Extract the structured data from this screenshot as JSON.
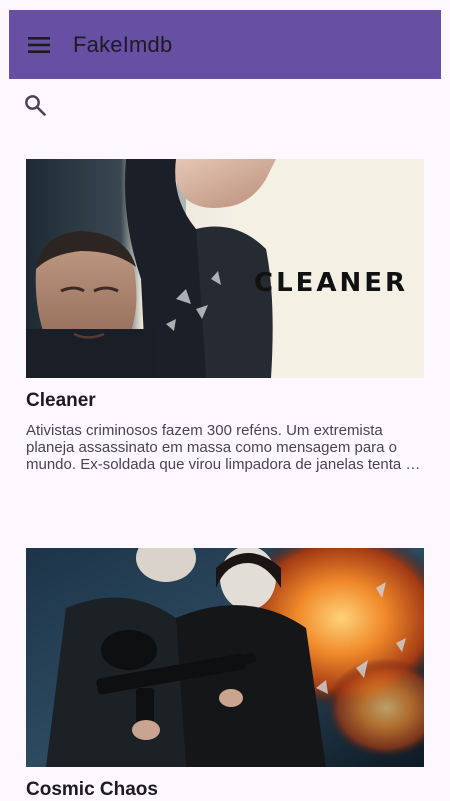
{
  "app": {
    "title": "FakeImdb",
    "colors": {
      "top_bar": "#6750a4",
      "background": "#fdf7ff",
      "text_primary": "#1d1b20",
      "text_secondary": "#49454f"
    },
    "icons": {
      "menu": "menu-icon",
      "search": "search-icon"
    }
  },
  "movies": [
    {
      "title": "Cleaner",
      "poster_text": "CLEANER",
      "description": "Ativistas criminosos fazem 300 reféns. Um extremista planeja assassinato em massa como mensagem para o mundo. Ex-soldada que virou limpadora de janelas tenta …"
    },
    {
      "title": "Cosmic Chaos",
      "description": ""
    }
  ]
}
